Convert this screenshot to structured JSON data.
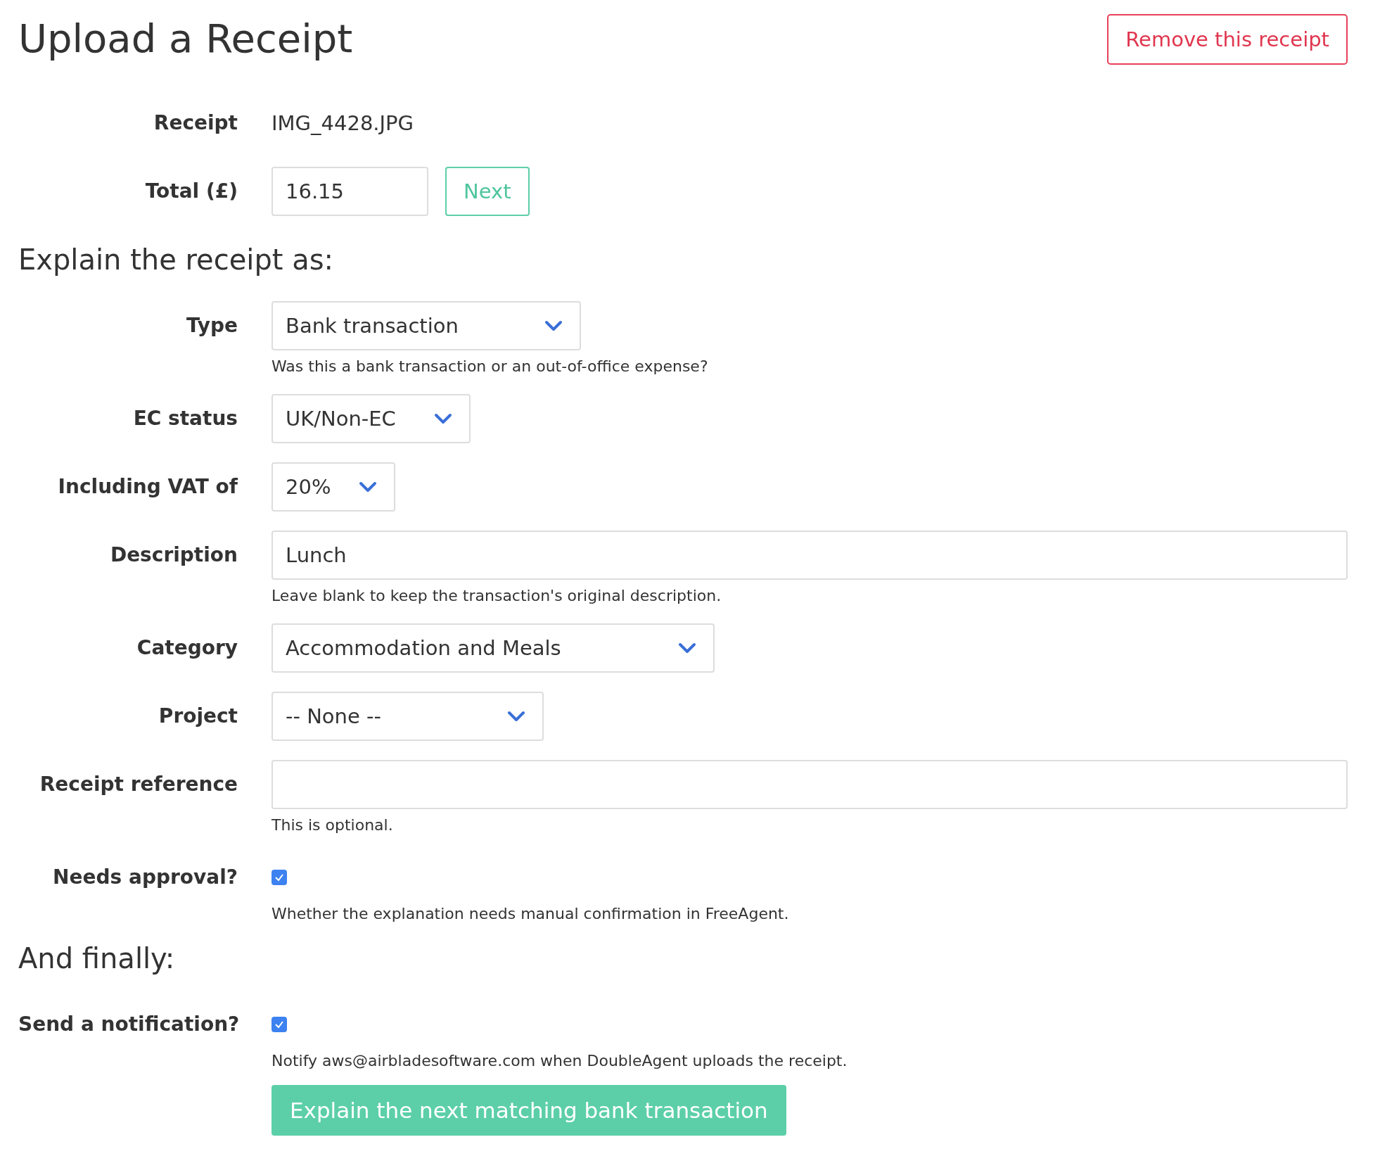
{
  "title": "Upload a Receipt",
  "remove_button": "Remove this receipt",
  "receipt": {
    "label": "Receipt",
    "value": "IMG_4428.JPG"
  },
  "total": {
    "label": "Total (£)",
    "value": "16.15",
    "button": "Next"
  },
  "explain_heading": "Explain the receipt as:",
  "fields": [
    {
      "kind": "select",
      "label": "Type",
      "value": "Bank transaction",
      "help": "Was this a bank transaction or an out-of-office expense?"
    },
    {
      "kind": "select",
      "label": "EC status",
      "value": "UK/Non-EC"
    },
    {
      "kind": "select",
      "label": "Including VAT of",
      "value": "20%"
    },
    {
      "kind": "input",
      "label": "Description",
      "value": "Lunch",
      "help": "Leave blank to keep the transaction's original description."
    },
    {
      "kind": "select",
      "label": "Category",
      "value": "Accommodation and Meals"
    },
    {
      "kind": "select",
      "label": "Project",
      "value": "-- None --"
    },
    {
      "kind": "input",
      "label": "Receipt reference",
      "help": "This is optional."
    },
    {
      "kind": "checkbox",
      "label": "Needs approval?",
      "checked": true,
      "help": "Whether the explanation needs manual confirmation in FreeAgent."
    }
  ],
  "final_heading": "And finally:",
  "final_fields": [
    {
      "kind": "checkbox",
      "label": "Send a notification?",
      "checked": true,
      "help": "Notify aws@airbladesoftware.com when DoubleAgent uploads the receipt."
    }
  ],
  "submit_button": "Explain the next matching bank transaction"
}
